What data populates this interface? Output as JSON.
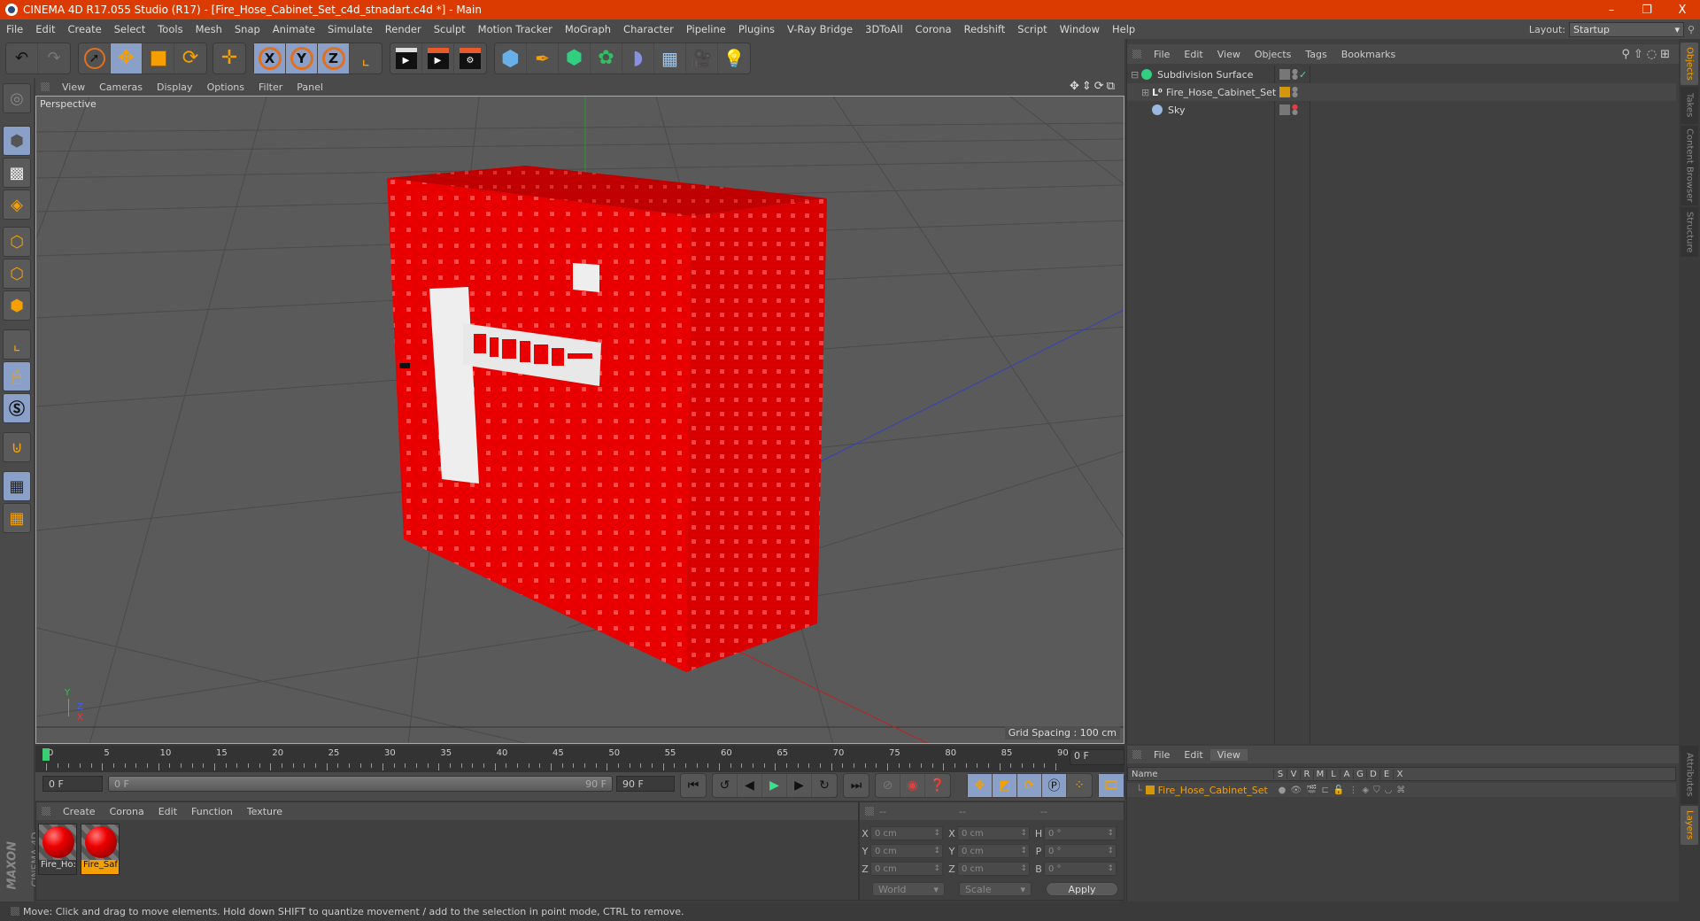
{
  "window": {
    "title": "CINEMA 4D R17.055 Studio (R17) - [Fire_Hose_Cabinet_Set_c4d_stnadart.c4d *] - Main",
    "controls": {
      "minimize": "–",
      "restore": "❐",
      "close": "X"
    }
  },
  "menubar": {
    "items": [
      "File",
      "Edit",
      "Create",
      "Select",
      "Tools",
      "Mesh",
      "Snap",
      "Animate",
      "Simulate",
      "Render",
      "Sculpt",
      "Motion Tracker",
      "MoGraph",
      "Character",
      "Pipeline",
      "Plugins",
      "V-Ray Bridge",
      "3DToAll",
      "Corona",
      "Redshift",
      "Script",
      "Window",
      "Help"
    ],
    "layout_label": "Layout:",
    "layout_value": "Startup"
  },
  "toolbar": {
    "groups": [
      [
        "undo-icon",
        "redo-icon"
      ],
      [
        "select-icon",
        "move-icon",
        "scale-icon",
        "rotate-icon"
      ],
      [
        "move-plus-icon"
      ],
      [
        "x-axis-icon",
        "y-axis-icon",
        "z-axis-icon",
        "coordinate-system-icon"
      ],
      [
        "render-view-icon",
        "render-picture-viewer-icon",
        "render-settings-icon"
      ],
      [
        "cube-icon",
        "pen-icon",
        "subdivision-icon",
        "cloner-icon",
        "deformer-icon",
        "floor-icon",
        "camera-icon",
        "light-icon"
      ]
    ],
    "axis_labels": [
      "X",
      "Y",
      "Z"
    ]
  },
  "left_tools": [
    "make-editable-icon",
    "model-mode-icon",
    "texture-mode-icon",
    "workplane-mode-icon",
    "points-mode-icon",
    "edges-mode-icon",
    "polygons-mode-icon",
    "axis-mode-icon",
    "tweak-mode-icon",
    "solo-icon",
    "snap-icon",
    "locked-workplane-icon",
    "planar-workplane-icon"
  ],
  "viewport": {
    "menu": [
      "View",
      "Cameras",
      "Display",
      "Options",
      "Filter",
      "Panel"
    ],
    "label": "Perspective",
    "grid_spacing": "Grid Spacing : 100 cm",
    "axis_gizmo": {
      "y": "Y",
      "z": "Z",
      "x": "X"
    }
  },
  "timeline": {
    "ticks": [
      "0",
      "5",
      "10",
      "15",
      "20",
      "25",
      "30",
      "35",
      "40",
      "45",
      "50",
      "55",
      "60",
      "65",
      "70",
      "75",
      "80",
      "85",
      "90"
    ],
    "current_frame_field": "0 F"
  },
  "playbar": {
    "start_field": "0 F",
    "range_start": "0 F",
    "range_end": "90 F",
    "end_field": "90 F"
  },
  "material_manager": {
    "menu": [
      "Create",
      "Corona",
      "Edit",
      "Function",
      "Texture"
    ],
    "materials": [
      {
        "name": "Fire_Ho:",
        "selected": false
      },
      {
        "name": "Fire_Saf",
        "selected": true
      }
    ]
  },
  "coordinates": {
    "headers": [
      "--",
      "--",
      "--"
    ],
    "rows": [
      {
        "l1": "X",
        "v1": "0 cm",
        "l2": "X",
        "v2": "0 cm",
        "l3": "H",
        "v3": "0 °"
      },
      {
        "l1": "Y",
        "v1": "0 cm",
        "l2": "Y",
        "v2": "0 cm",
        "l3": "P",
        "v3": "0 °"
      },
      {
        "l1": "Z",
        "v1": "0 cm",
        "l2": "Z",
        "v2": "0 cm",
        "l3": "B",
        "v3": "0 °"
      }
    ],
    "world": "World",
    "scale": "Scale",
    "apply": "Apply"
  },
  "object_manager": {
    "menu": [
      "File",
      "Edit",
      "View",
      "Objects",
      "Tags",
      "Bookmarks"
    ],
    "objects": [
      {
        "name": "Subdivision Surface",
        "icon": "subdivision-icon",
        "indent": 0
      },
      {
        "name": "Fire_Hose_Cabinet_Set",
        "icon": "null-object-icon",
        "indent": 1
      },
      {
        "name": "Sky",
        "icon": "sky-icon",
        "indent": 0
      }
    ]
  },
  "side_tabs": {
    "top": [
      "Objects",
      "Takes",
      "Content Browser",
      "Structure"
    ],
    "bottom": [
      "Attributes",
      "Layers"
    ]
  },
  "layer_manager": {
    "menu": [
      "File",
      "Edit",
      "View"
    ],
    "columns": [
      "Name",
      "S",
      "V",
      "R",
      "M",
      "L",
      "A",
      "G",
      "D",
      "E",
      "X"
    ],
    "layers": [
      {
        "name": "Fire_Hose_Cabinet_Set",
        "color": "#d4960a"
      }
    ]
  },
  "branding": {
    "maxon": "MAXON",
    "product": "CINEMA 4D"
  },
  "status": "Move: Click and drag to move elements. Hold down SHIFT to quantize movement / add to the selection in point mode, CTRL to remove.",
  "colors": {
    "titlebar": "#db3b00",
    "accent": "#f5a000",
    "selected_tool": "#8aa0c8"
  }
}
